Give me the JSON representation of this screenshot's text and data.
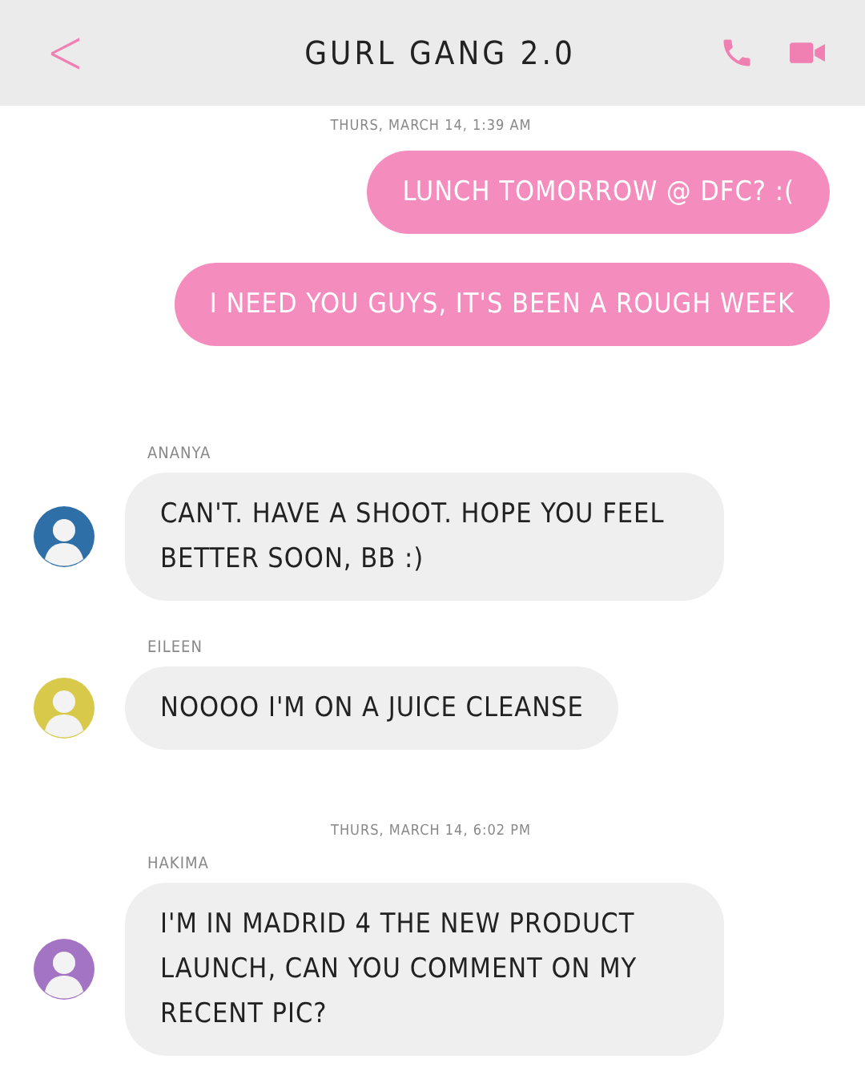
{
  "header": {
    "back": "<",
    "title": "GURL GANG 2.0"
  },
  "messages": [
    {
      "kind": "timestamp",
      "text": "THURS, MARCH 14, 1:39 AM"
    },
    {
      "kind": "outgoing",
      "text": "LUNCH TOMORROW @ DFC? :("
    },
    {
      "kind": "outgoing",
      "text": "I NEED YOU GUYS, IT'S BEEN A ROUGH WEEK"
    },
    {
      "kind": "incoming",
      "sender": "ANANYA",
      "text": "CAN'T. HAVE A SHOOT. HOPE YOU FEEL BETTER SOON, BB :)",
      "color": "#2f6fa8"
    },
    {
      "kind": "incoming",
      "sender": "EILEEN",
      "text": "NOOOO I'M ON A JUICE CLEANSE",
      "color": "#d8c94a"
    },
    {
      "kind": "timestamp",
      "text": "THURS, MARCH 14, 6:02 PM"
    },
    {
      "kind": "incoming",
      "sender": "HAKIMA",
      "text": "I'M IN MADRID 4 THE NEW PRODUCT LAUNCH, CAN YOU COMMENT ON MY RECENT PIC?",
      "color": "#a474c4"
    }
  ]
}
